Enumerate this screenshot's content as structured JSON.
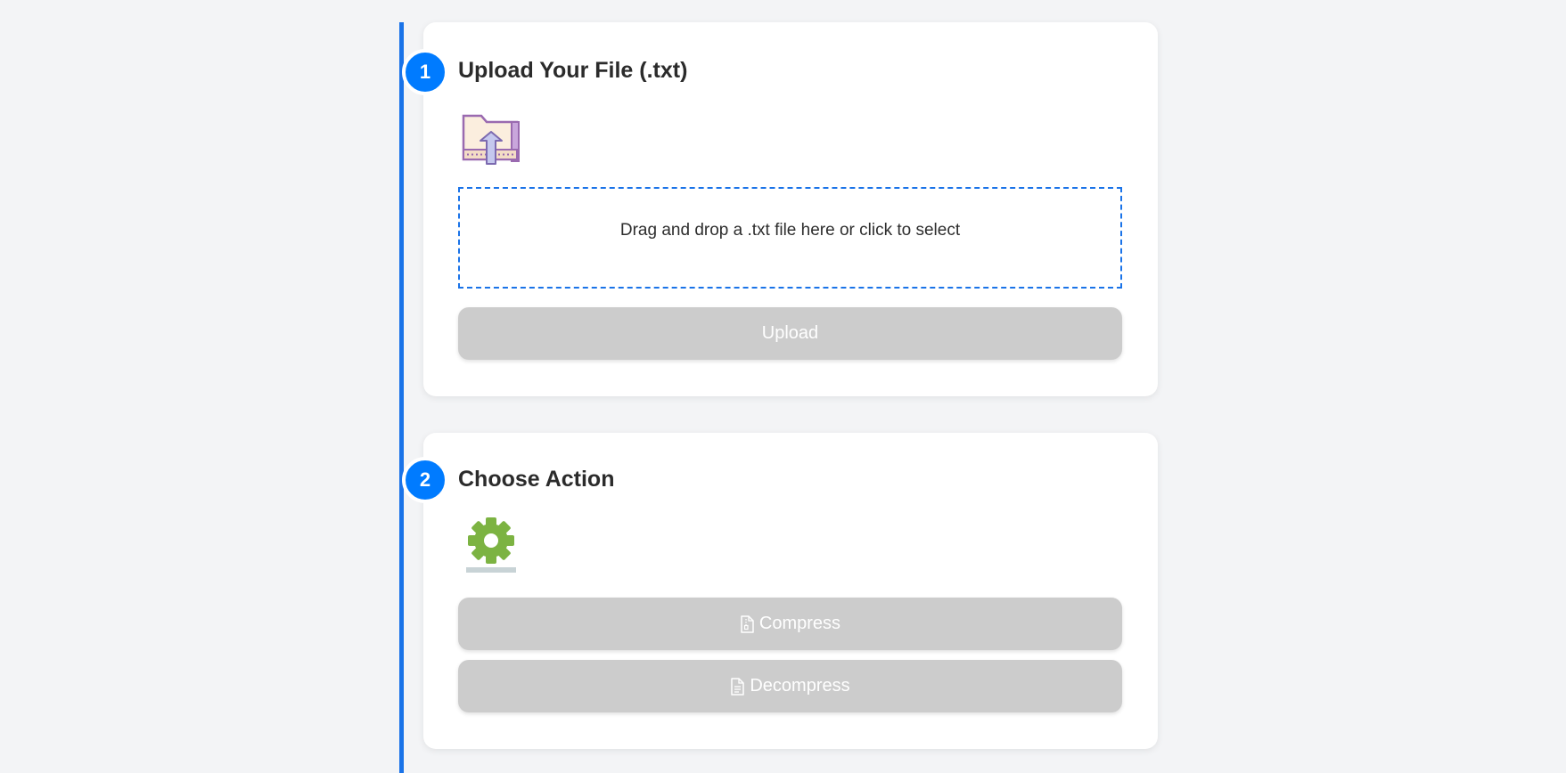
{
  "step1": {
    "number": "1",
    "title": "Upload Your File (.txt)",
    "icon": "folder-upload-icon",
    "dropzone_text": "Drag and drop a .txt file here or click to select",
    "upload_label": "Upload"
  },
  "step2": {
    "number": "2",
    "title": "Choose Action",
    "icon": "gear-icon",
    "compress_label": "Compress",
    "decompress_label": "Decompress",
    "compress_icon": "file-zip-icon",
    "decompress_icon": "file-text-icon"
  },
  "colors": {
    "accent": "#007bff",
    "timeline": "#1a73e8",
    "disabled_button": "#cccccc",
    "background": "#f3f4f6"
  }
}
